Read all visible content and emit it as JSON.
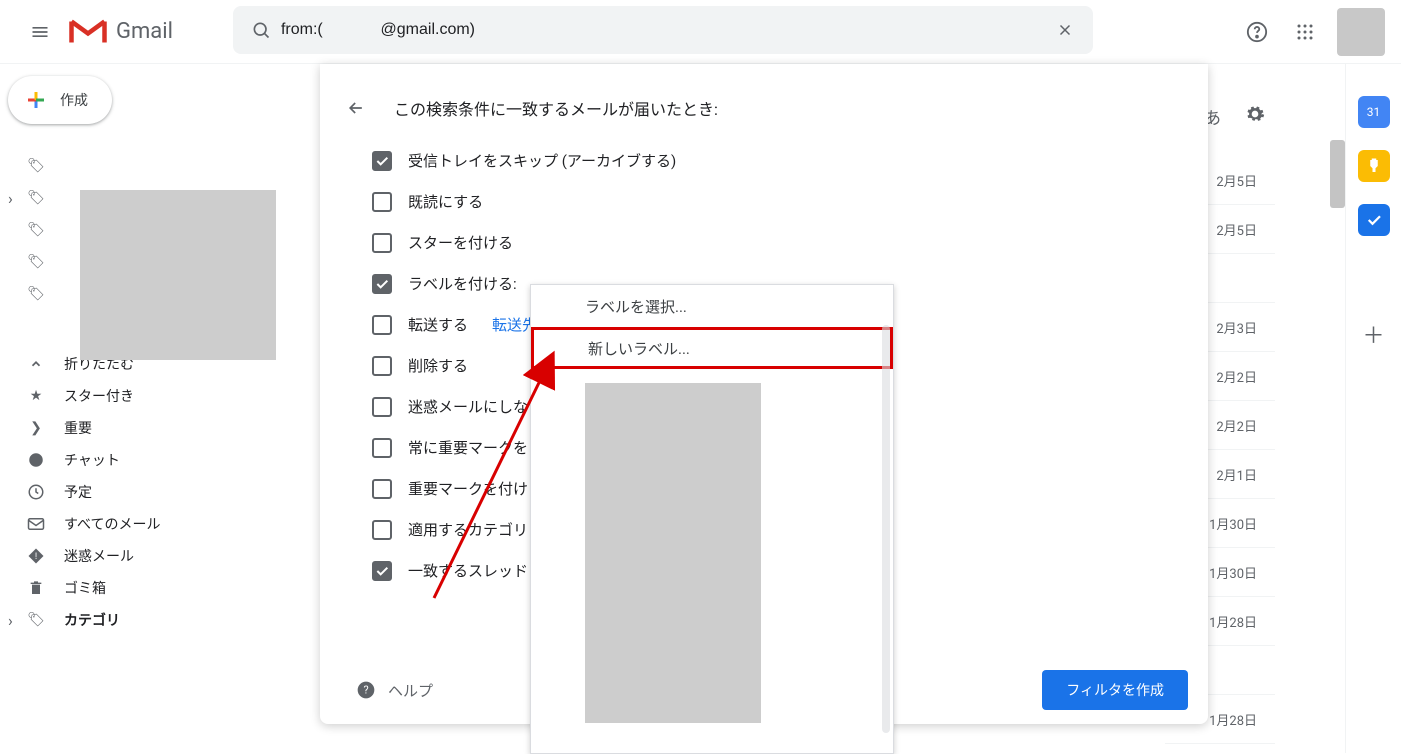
{
  "app": {
    "name": "Gmail"
  },
  "search": {
    "value": "from:(             @gmail.com)"
  },
  "compose_label": "作成",
  "sidebar": {
    "items": [
      {
        "icon": "label",
        "label": ""
      },
      {
        "icon": "label",
        "label": ""
      },
      {
        "icon": "label",
        "label": ""
      },
      {
        "icon": "label",
        "label": ""
      },
      {
        "icon": "label",
        "label": ""
      },
      {
        "icon": "collapse",
        "label": "折りたたむ"
      },
      {
        "icon": "star",
        "label": "スター付き"
      },
      {
        "icon": "important",
        "label": "重要"
      },
      {
        "icon": "chat",
        "label": "チャット"
      },
      {
        "icon": "scheduled",
        "label": "予定"
      },
      {
        "icon": "mail",
        "label": "すべてのメール"
      },
      {
        "icon": "spam",
        "label": "迷惑メール"
      },
      {
        "icon": "trash",
        "label": "ゴミ箱"
      },
      {
        "icon": "category",
        "label": "カテゴリ"
      }
    ]
  },
  "dates": [
    "2月5日",
    "2月5日",
    "",
    "2月3日",
    "2月2日",
    "2月2日",
    "2月1日",
    "1月30日",
    "1月30日",
    "1月28日",
    "",
    "1月28日"
  ],
  "filter": {
    "title": "この検索条件に一致するメールが届いたとき:",
    "options": [
      {
        "checked": true,
        "label": "受信トレイをスキップ (アーカイブする)"
      },
      {
        "checked": false,
        "label": "既読にする"
      },
      {
        "checked": false,
        "label": "スターを付ける"
      },
      {
        "checked": true,
        "label": "ラベルを付ける:"
      },
      {
        "checked": false,
        "label": "転送する",
        "link": "転送先"
      },
      {
        "checked": false,
        "label": "削除する"
      },
      {
        "checked": false,
        "label": "迷惑メールにしな"
      },
      {
        "checked": false,
        "label": "常に重要マークを"
      },
      {
        "checked": false,
        "label": "重要マークを付け"
      },
      {
        "checked": false,
        "label": "適用するカテゴリ"
      },
      {
        "checked": true,
        "label": "一致するスレッド"
      }
    ],
    "help_label": "ヘルプ",
    "create_label": "フィルタを作成"
  },
  "label_dropdown": {
    "select_label": "ラベルを選択...",
    "new_label": "新しいラベル..."
  },
  "rightbar": {
    "calendar_day": "31"
  }
}
